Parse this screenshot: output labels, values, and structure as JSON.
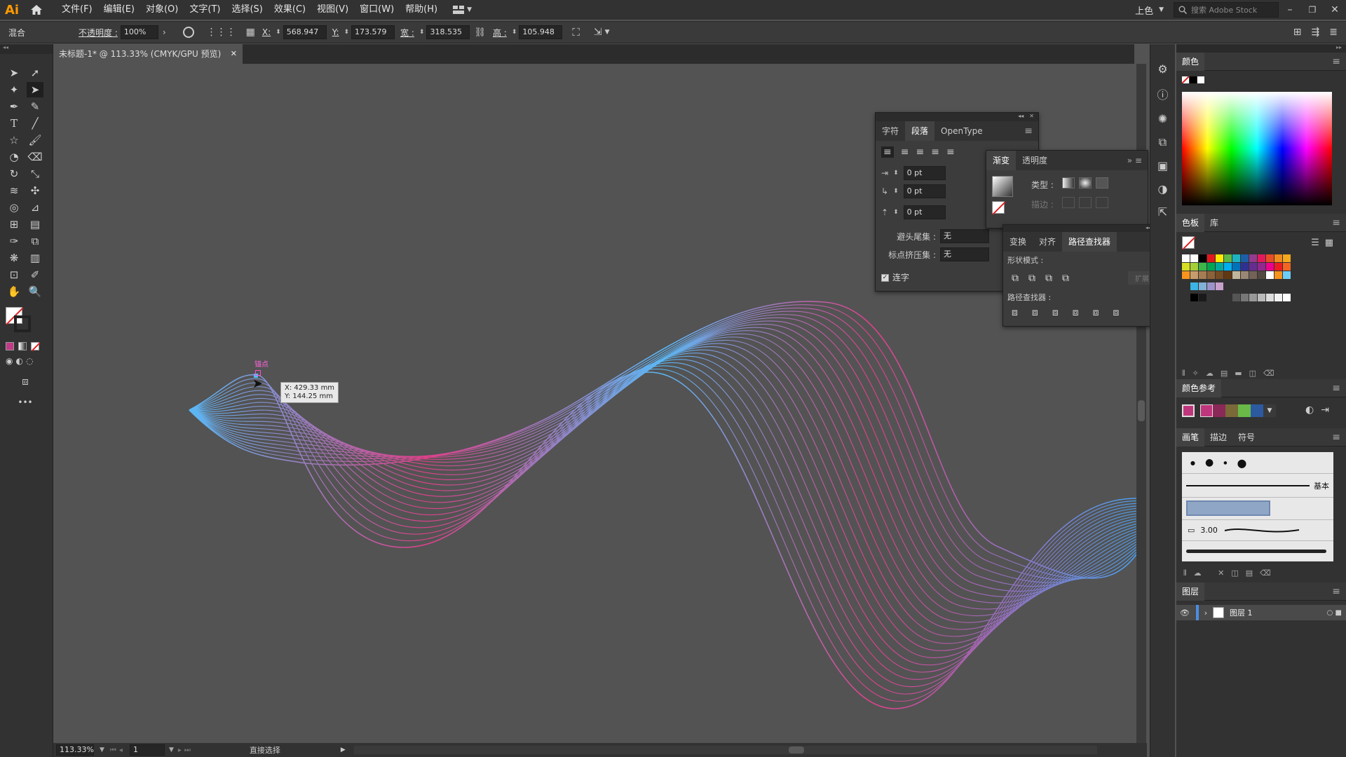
{
  "app": {
    "logo": "Ai",
    "menus": [
      "文件(F)",
      "编辑(E)",
      "对象(O)",
      "文字(T)",
      "选择(S)",
      "效果(C)",
      "视图(V)",
      "窗口(W)",
      "帮助(H)"
    ],
    "workspace": "上色",
    "search_placeholder": "搜索 Adobe Stock"
  },
  "control": {
    "blend_label": "混合",
    "opacity_label": "不透明度 :",
    "opacity_value": "100%",
    "x_label": "X:",
    "x_value": "568.947",
    "y_label": "Y:",
    "y_value": "173.579",
    "w_label": "宽 :",
    "w_value": "318.535",
    "h_label": "高 :",
    "h_value": "105.948"
  },
  "document": {
    "tab_title": "未标题-1* @ 113.33% (CMYK/GPU 预览)"
  },
  "canvas": {
    "anchor_label": "锚点",
    "tooltip_x": "X: 429.33 mm",
    "tooltip_y": "Y: 144.25 mm",
    "wave_colors": {
      "start": "#5ab8f5",
      "mid": "#e0408a",
      "end": "#4aa0f0"
    }
  },
  "paragraph_panel": {
    "tabs": [
      "字符",
      "段落",
      "OpenType"
    ],
    "indent_left": "0 pt",
    "indent_first": "0 pt",
    "space_before": "0 pt",
    "avoid_label": "避头尾集 :",
    "avoid_value": "无",
    "punct_label": "标点挤压集 :",
    "punct_value": "无",
    "hyphen_label": "连字"
  },
  "gradient_panel": {
    "tabs": [
      "渐变",
      "透明度"
    ],
    "type_label": "类型 :",
    "stroke_label": "描边 :"
  },
  "pathfinder_panel": {
    "tabs": [
      "变换",
      "对齐",
      "路径查找器"
    ],
    "shape_modes_label": "形状模式 :",
    "expand_label": "扩展",
    "pathfinders_label": "路径查找器 :"
  },
  "right": {
    "color_title": "颜色",
    "swatches_tabs": [
      "色板",
      "库"
    ],
    "color_guide_title": "颜色参考",
    "brush_tabs": [
      "画笔",
      "描边",
      "符号"
    ],
    "brush_basic": "基本",
    "brush_size": "3.00",
    "layers_title": "图层",
    "layer_name": "图层 1"
  },
  "status": {
    "zoom": "113.33%",
    "page": "1",
    "tool": "直接选择"
  }
}
